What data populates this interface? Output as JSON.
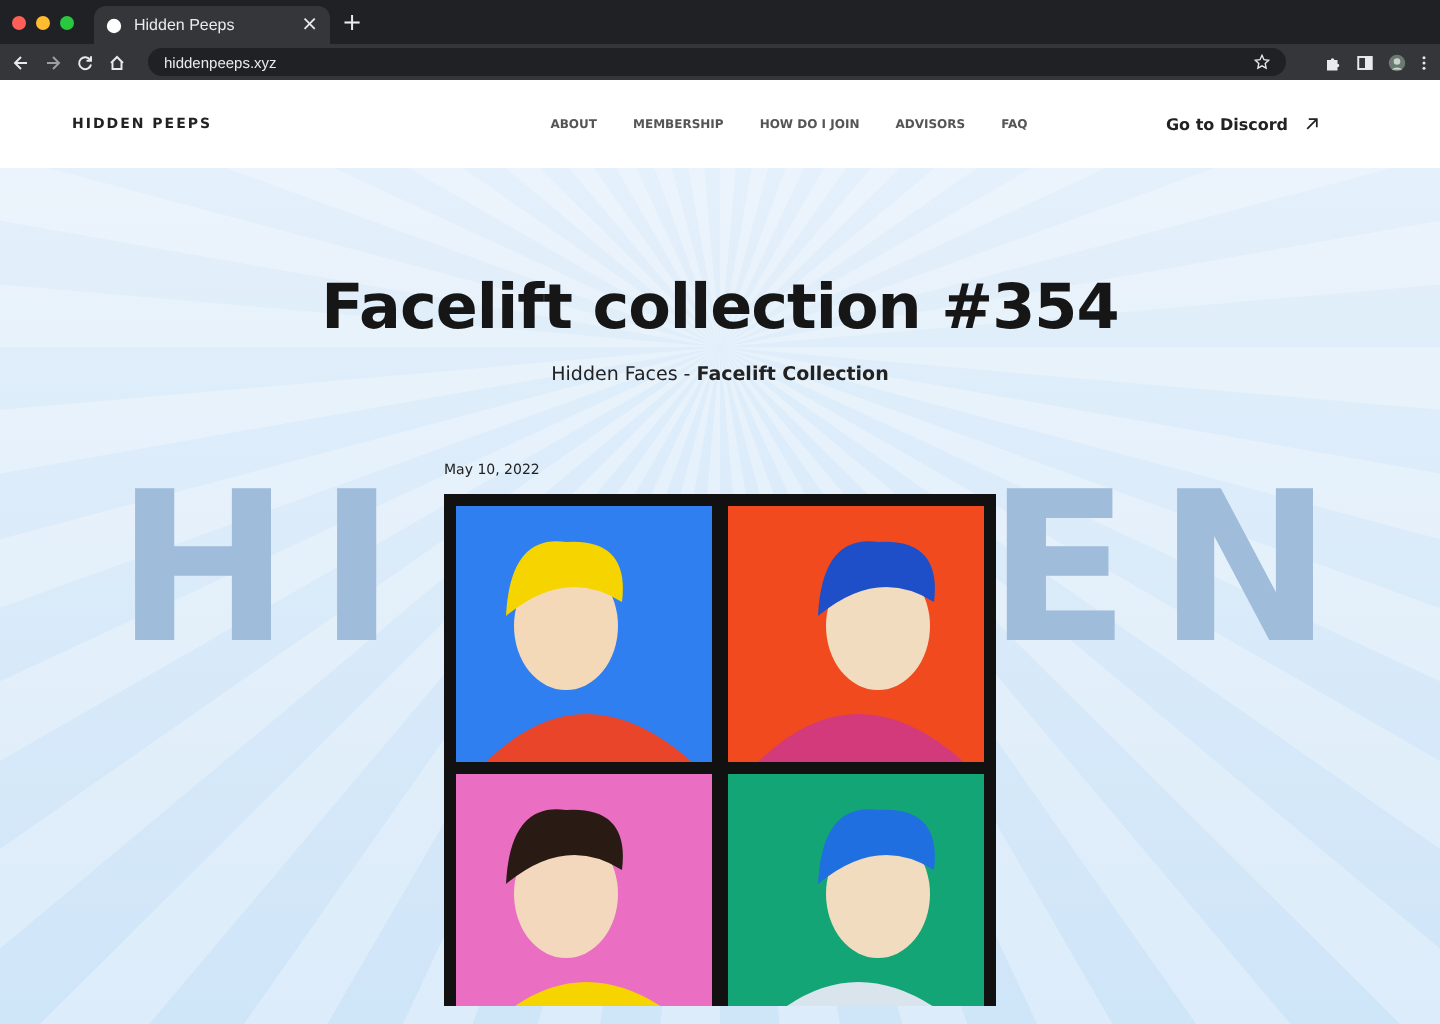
{
  "browser": {
    "tab_title": "Hidden Peeps",
    "new_tab": "+",
    "close_tab": "×",
    "address": "hiddenpeeps.xyz"
  },
  "nav": {
    "logo": "HIDDEN PEEPS",
    "links": [
      {
        "label": "ABOUT"
      },
      {
        "label": "MEMBERSHIP"
      },
      {
        "label": "HOW DO I JOIN"
      },
      {
        "label": "ADVISORS"
      },
      {
        "label": "FAQ"
      }
    ],
    "cta": "Go to Discord"
  },
  "hero": {
    "background_text": [
      "HI",
      "EN"
    ],
    "title": "Facelift collection #354",
    "subtitle": "Hidden Faces - **Facelift Collection**",
    "date": "May 10, 2022"
  }
}
